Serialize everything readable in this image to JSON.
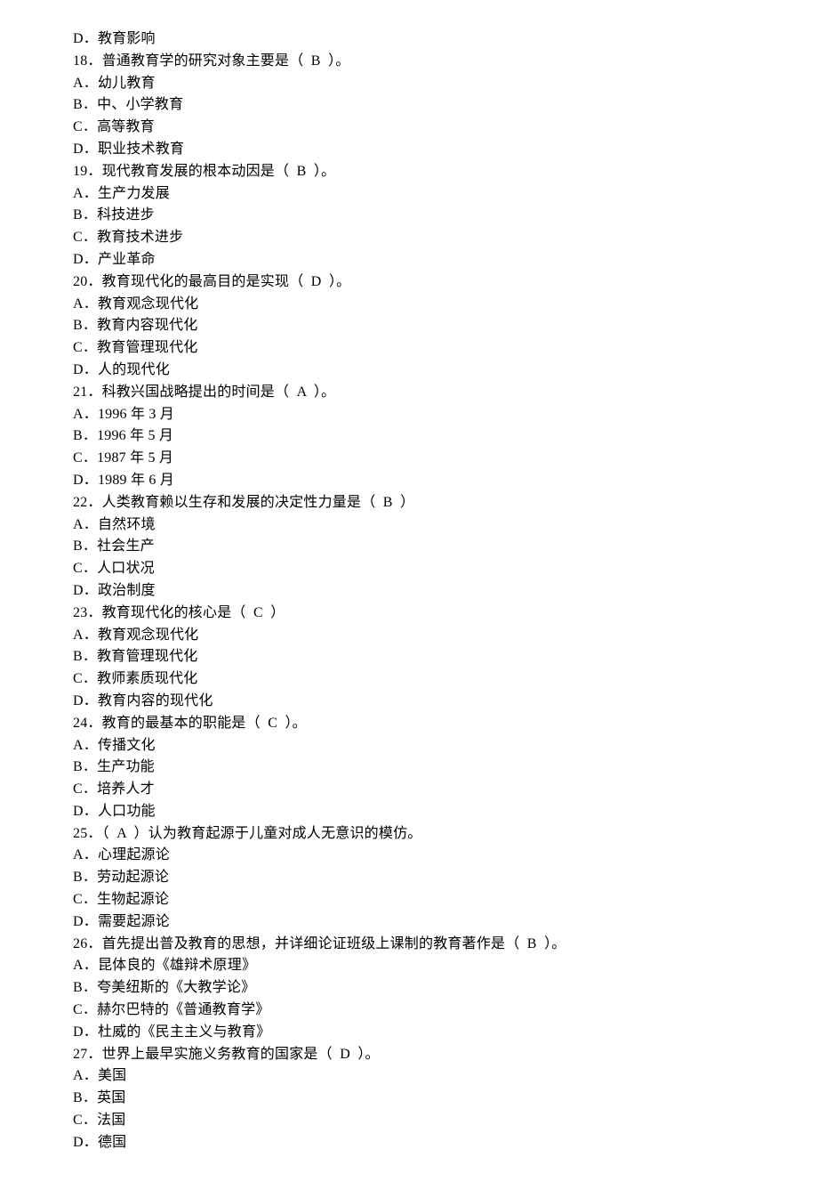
{
  "lines": [
    "D．教育影响",
    "18．普通教育学的研究对象主要是（  B  ）。",
    "A．幼儿教育",
    "B．中、小学教育",
    "C．高等教育",
    "D．职业技术教育",
    "19．现代教育发展的根本动因是（  B  ）。",
    "A．生产力发展",
    "B．科技进步",
    "C．教育技术进步",
    "D．产业革命",
    "20．教育现代化的最高目的是实现（  D  ）。",
    "A．教育观念现代化",
    "B．教育内容现代化",
    "C．教育管理现代化",
    "D．人的现代化",
    "21．科教兴国战略提出的时间是（  A  ）。",
    "A．1996 年 3 月",
    "B．1996 年 5 月",
    "C．1987 年 5 月",
    "D．1989 年 6 月",
    "22．人类教育赖以生存和发展的决定性力量是（  B  ）",
    "A．自然环境",
    "B．社会生产",
    "C．人口状况",
    "D．政治制度",
    "23．教育现代化的核心是（  C  ）",
    "A．教育观念现代化",
    "B．教育管理现代化",
    "C．教师素质现代化",
    "D．教育内容的现代化",
    "24．教育的最基本的职能是（  C  ）。",
    "A．传播文化",
    "B．生产功能",
    "C．培养人才",
    "D．人口功能",
    "25．（  A  ）认为教育起源于儿童对成人无意识的模仿。",
    "A．心理起源论",
    "B．劳动起源论",
    "C．生物起源论",
    "D．需要起源论",
    "26．首先提出普及教育的思想，并详细论证班级上课制的教育著作是（  B  ）。",
    "A．昆体良的《雄辩术原理》",
    "B．夸美纽斯的《大教学论》",
    "C．赫尔巴特的《普通教育学》",
    "D．杜威的《民主主义与教育》",
    "27．世界上最早实施义务教育的国家是（  D  ）。",
    "A．美国",
    "B．英国",
    "C．法国",
    "D．德国"
  ]
}
